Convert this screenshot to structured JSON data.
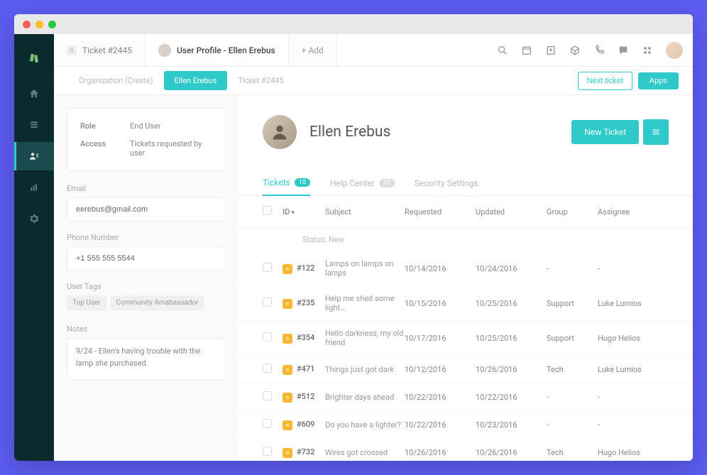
{
  "tabs": {
    "ticket": "Ticket #2445",
    "profile": "User Profile - Ellen Erebus",
    "add": "+ Add"
  },
  "nav_tabs": {
    "org": "Organization (Create)",
    "user": "Ellen Erebus",
    "ticket": "Ticket #2445"
  },
  "buttons": {
    "next_ticket": "Next ticket",
    "apps": "Apps",
    "new_ticket": "New Ticket"
  },
  "info": {
    "role_label": "Role",
    "role_value": "End User",
    "access_label": "Access",
    "access_value": "Tickets requested by user"
  },
  "fields": {
    "email_label": "Email",
    "email_value": "eerebus@gmail.com",
    "phone_label": "Phone Number",
    "phone_value": "+1 555 555 5544",
    "tags_label": "User Tags",
    "notes_label": "Notes",
    "notes_value": "9/24 - Ellen's having trouble with the lamp she purchased."
  },
  "tags": [
    "Top User",
    "Community Amabassador"
  ],
  "profile": {
    "name": "Ellen Erebus"
  },
  "inner_tabs": {
    "tickets_label": "Tickets",
    "tickets_count": "10",
    "help_label": "Help Center",
    "help_count": "10",
    "security_label": "Security Settings"
  },
  "columns": {
    "id": "ID",
    "subject": "Subject",
    "requested": "Requested",
    "updated": "Updated",
    "group": "Group",
    "assignee": "Assignee"
  },
  "status_label": "Status: New",
  "tickets": [
    {
      "id": "#122",
      "subject": "Lamps on lamps on lamps",
      "requested": "10/14/2016",
      "updated": "10/24/2016",
      "group": "-",
      "assignee": "-"
    },
    {
      "id": "#235",
      "subject": "Help me shed some light...",
      "requested": "10/15/2016",
      "updated": "10/25/2016",
      "group": "Support",
      "assignee": "Luke Lumios"
    },
    {
      "id": "#354",
      "subject": "Hello darkness, my old friend",
      "requested": "10/17/2016",
      "updated": "10/25/2016",
      "group": "Support",
      "assignee": "Hugo Helios"
    },
    {
      "id": "#471",
      "subject": "Things just got dark",
      "requested": "10/12/2016",
      "updated": "10/26/2016",
      "group": "Tech",
      "assignee": "Luke Lumios"
    },
    {
      "id": "#512",
      "subject": "Brighter days ahead",
      "requested": "10/22/2016",
      "updated": "10/22/2016",
      "group": "-",
      "assignee": "-"
    },
    {
      "id": "#609",
      "subject": "Do you have a lighter?",
      "requested": "10/22/2016",
      "updated": "10/23/2016",
      "group": "-",
      "assignee": "-"
    },
    {
      "id": "#732",
      "subject": "Wires got crossed",
      "requested": "10/26/2016",
      "updated": "10/26/2016",
      "group": "Tech",
      "assignee": "Hugo Helios"
    }
  ]
}
